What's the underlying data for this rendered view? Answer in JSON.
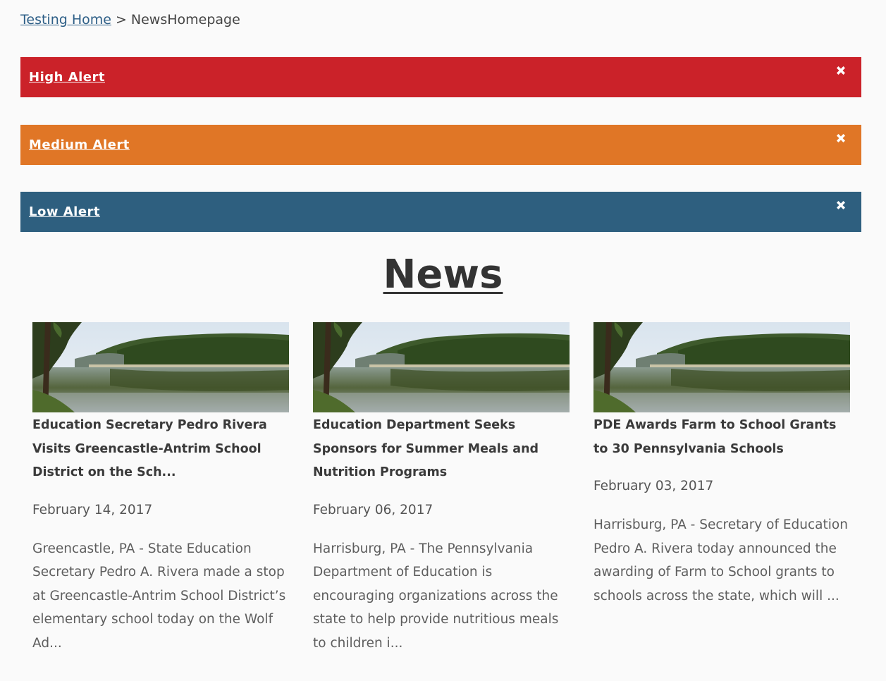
{
  "breadcrumb": {
    "home_label": "Testing Home",
    "separator": ">",
    "current": "NewsHomepage"
  },
  "alerts": [
    {
      "label": "High Alert",
      "color": "#cb2229"
    },
    {
      "label": "Medium Alert",
      "color": "#e07626"
    },
    {
      "label": "Low Alert",
      "color": "#2e5f7f"
    }
  ],
  "news": {
    "heading": "News",
    "articles": [
      {
        "title": "Education Secretary Pedro Rivera Visits Greencastle-Antrim School District on the Sch...",
        "date": "February 14, 2017",
        "excerpt": "Greencastle, PA - State Education Secretary Pedro A. Rivera made a stop at Greencastle-Antrim School District’s elementary school today on the Wolf Ad..."
      },
      {
        "title": "Education Department Seeks Sponsors for Summer Meals and Nutrition Programs",
        "date": "February 06, 2017",
        "excerpt": "Harrisburg, PA - The Pennsylvania Department of Education is encouraging organizations across the state to help provide nutritious meals to children i..."
      },
      {
        "title": "PDE Awards Farm to School Grants to 30 Pennsylvania Schools",
        "date": "February 03, 2017",
        "excerpt": "Harrisburg, PA - Secretary of Education Pedro A. Rivera today announced the awarding of Farm to School grants to schools across the state, which will ..."
      }
    ]
  },
  "icons": {
    "alert_close": "close-icon",
    "article_image": "lake-landscape-image"
  }
}
